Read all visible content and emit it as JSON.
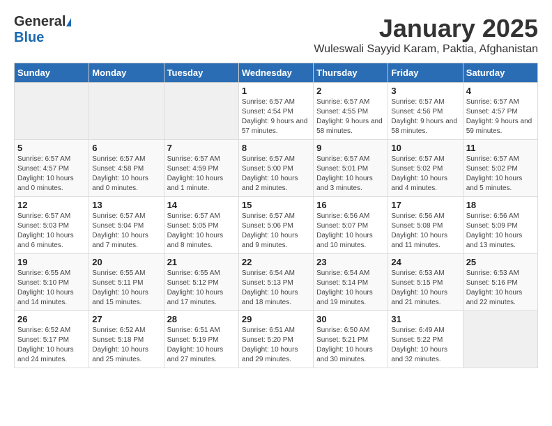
{
  "header": {
    "logo_general": "General",
    "logo_blue": "Blue",
    "title": "January 2025",
    "subtitle": "Wuleswali Sayyid Karam, Paktia, Afghanistan"
  },
  "days_of_week": [
    "Sunday",
    "Monday",
    "Tuesday",
    "Wednesday",
    "Thursday",
    "Friday",
    "Saturday"
  ],
  "weeks": [
    [
      {
        "day": "",
        "info": ""
      },
      {
        "day": "",
        "info": ""
      },
      {
        "day": "",
        "info": ""
      },
      {
        "day": "1",
        "info": "Sunrise: 6:57 AM\nSunset: 4:54 PM\nDaylight: 9 hours and 57 minutes."
      },
      {
        "day": "2",
        "info": "Sunrise: 6:57 AM\nSunset: 4:55 PM\nDaylight: 9 hours and 58 minutes."
      },
      {
        "day": "3",
        "info": "Sunrise: 6:57 AM\nSunset: 4:56 PM\nDaylight: 9 hours and 58 minutes."
      },
      {
        "day": "4",
        "info": "Sunrise: 6:57 AM\nSunset: 4:57 PM\nDaylight: 9 hours and 59 minutes."
      }
    ],
    [
      {
        "day": "5",
        "info": "Sunrise: 6:57 AM\nSunset: 4:57 PM\nDaylight: 10 hours and 0 minutes."
      },
      {
        "day": "6",
        "info": "Sunrise: 6:57 AM\nSunset: 4:58 PM\nDaylight: 10 hours and 0 minutes."
      },
      {
        "day": "7",
        "info": "Sunrise: 6:57 AM\nSunset: 4:59 PM\nDaylight: 10 hours and 1 minute."
      },
      {
        "day": "8",
        "info": "Sunrise: 6:57 AM\nSunset: 5:00 PM\nDaylight: 10 hours and 2 minutes."
      },
      {
        "day": "9",
        "info": "Sunrise: 6:57 AM\nSunset: 5:01 PM\nDaylight: 10 hours and 3 minutes."
      },
      {
        "day": "10",
        "info": "Sunrise: 6:57 AM\nSunset: 5:02 PM\nDaylight: 10 hours and 4 minutes."
      },
      {
        "day": "11",
        "info": "Sunrise: 6:57 AM\nSunset: 5:02 PM\nDaylight: 10 hours and 5 minutes."
      }
    ],
    [
      {
        "day": "12",
        "info": "Sunrise: 6:57 AM\nSunset: 5:03 PM\nDaylight: 10 hours and 6 minutes."
      },
      {
        "day": "13",
        "info": "Sunrise: 6:57 AM\nSunset: 5:04 PM\nDaylight: 10 hours and 7 minutes."
      },
      {
        "day": "14",
        "info": "Sunrise: 6:57 AM\nSunset: 5:05 PM\nDaylight: 10 hours and 8 minutes."
      },
      {
        "day": "15",
        "info": "Sunrise: 6:57 AM\nSunset: 5:06 PM\nDaylight: 10 hours and 9 minutes."
      },
      {
        "day": "16",
        "info": "Sunrise: 6:56 AM\nSunset: 5:07 PM\nDaylight: 10 hours and 10 minutes."
      },
      {
        "day": "17",
        "info": "Sunrise: 6:56 AM\nSunset: 5:08 PM\nDaylight: 10 hours and 11 minutes."
      },
      {
        "day": "18",
        "info": "Sunrise: 6:56 AM\nSunset: 5:09 PM\nDaylight: 10 hours and 13 minutes."
      }
    ],
    [
      {
        "day": "19",
        "info": "Sunrise: 6:55 AM\nSunset: 5:10 PM\nDaylight: 10 hours and 14 minutes."
      },
      {
        "day": "20",
        "info": "Sunrise: 6:55 AM\nSunset: 5:11 PM\nDaylight: 10 hours and 15 minutes."
      },
      {
        "day": "21",
        "info": "Sunrise: 6:55 AM\nSunset: 5:12 PM\nDaylight: 10 hours and 17 minutes."
      },
      {
        "day": "22",
        "info": "Sunrise: 6:54 AM\nSunset: 5:13 PM\nDaylight: 10 hours and 18 minutes."
      },
      {
        "day": "23",
        "info": "Sunrise: 6:54 AM\nSunset: 5:14 PM\nDaylight: 10 hours and 19 minutes."
      },
      {
        "day": "24",
        "info": "Sunrise: 6:53 AM\nSunset: 5:15 PM\nDaylight: 10 hours and 21 minutes."
      },
      {
        "day": "25",
        "info": "Sunrise: 6:53 AM\nSunset: 5:16 PM\nDaylight: 10 hours and 22 minutes."
      }
    ],
    [
      {
        "day": "26",
        "info": "Sunrise: 6:52 AM\nSunset: 5:17 PM\nDaylight: 10 hours and 24 minutes."
      },
      {
        "day": "27",
        "info": "Sunrise: 6:52 AM\nSunset: 5:18 PM\nDaylight: 10 hours and 25 minutes."
      },
      {
        "day": "28",
        "info": "Sunrise: 6:51 AM\nSunset: 5:19 PM\nDaylight: 10 hours and 27 minutes."
      },
      {
        "day": "29",
        "info": "Sunrise: 6:51 AM\nSunset: 5:20 PM\nDaylight: 10 hours and 29 minutes."
      },
      {
        "day": "30",
        "info": "Sunrise: 6:50 AM\nSunset: 5:21 PM\nDaylight: 10 hours and 30 minutes."
      },
      {
        "day": "31",
        "info": "Sunrise: 6:49 AM\nSunset: 5:22 PM\nDaylight: 10 hours and 32 minutes."
      },
      {
        "day": "",
        "info": ""
      }
    ]
  ]
}
